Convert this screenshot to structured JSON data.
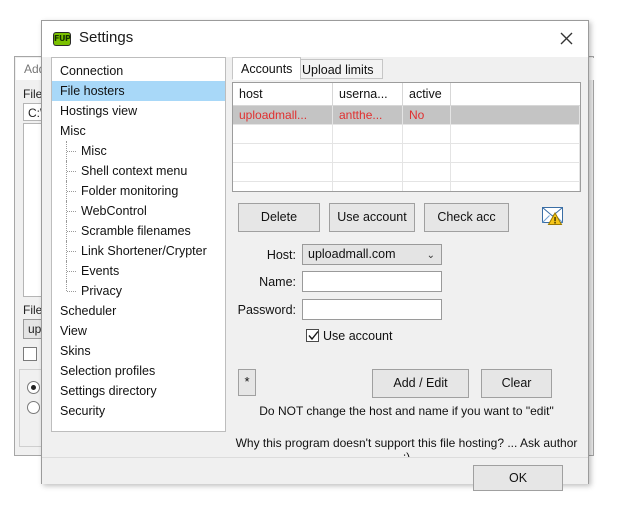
{
  "background_window": {
    "title": "Add",
    "file_label_1": "File",
    "path_value": "C:\\",
    "file_label_2": "File",
    "upload_field": "upl",
    "help_marker": "[?]",
    "close_icon": "close-icon"
  },
  "dialog": {
    "icon": "fup-app-icon",
    "icon_text": "FUP",
    "title": "Settings",
    "close_label": "✕",
    "ok_label": "OK",
    "footnote": "Why this program doesn't support this file hosting? ... Ask author :)"
  },
  "sidebar": {
    "items": [
      {
        "label": "Connection",
        "level": 0,
        "selected": false
      },
      {
        "label": "File hosters",
        "level": 0,
        "selected": true
      },
      {
        "label": "Hostings view",
        "level": 0,
        "selected": false
      },
      {
        "label": "Misc",
        "level": 0,
        "selected": false
      },
      {
        "label": "Misc",
        "level": 1,
        "selected": false
      },
      {
        "label": "Shell context menu",
        "level": 1,
        "selected": false
      },
      {
        "label": "Folder monitoring",
        "level": 1,
        "selected": false
      },
      {
        "label": "WebControl",
        "level": 1,
        "selected": false
      },
      {
        "label": "Scramble filenames",
        "level": 1,
        "selected": false
      },
      {
        "label": "Link Shortener/Crypter",
        "level": 1,
        "selected": false
      },
      {
        "label": "Events",
        "level": 1,
        "selected": false
      },
      {
        "label": "Privacy",
        "level": 1,
        "selected": false,
        "last": true
      },
      {
        "label": "Scheduler",
        "level": 0,
        "selected": false
      },
      {
        "label": "View",
        "level": 0,
        "selected": false
      },
      {
        "label": "Skins",
        "level": 0,
        "selected": false
      },
      {
        "label": "Selection profiles",
        "level": 0,
        "selected": false
      },
      {
        "label": "Settings directory",
        "level": 0,
        "selected": false
      },
      {
        "label": "Security",
        "level": 0,
        "selected": false
      }
    ]
  },
  "tabs": [
    {
      "label": "Accounts",
      "active": true
    },
    {
      "label": "Upload limits",
      "active": false
    }
  ],
  "accounts_table": {
    "columns": [
      "host",
      "userna...",
      "active",
      ""
    ],
    "rows": [
      {
        "selected": true,
        "cells": [
          "uploadmall...",
          "antthe...",
          "No",
          ""
        ]
      },
      {
        "selected": false,
        "cells": [
          "",
          "",
          "",
          ""
        ]
      },
      {
        "selected": false,
        "cells": [
          "",
          "",
          "",
          ""
        ]
      },
      {
        "selected": false,
        "cells": [
          "",
          "",
          "",
          ""
        ]
      },
      {
        "selected": false,
        "cells": [
          "",
          "",
          "",
          ""
        ]
      }
    ],
    "row_text_color": "#e03030",
    "selected_row_bg": "#c4c4c4"
  },
  "action_buttons": {
    "delete": "Delete",
    "use_account": "Use account",
    "check_acc": "Check acc",
    "mail_warning_icon": "mail-warning-icon"
  },
  "form": {
    "host_label": "Host:",
    "host_value": "uploadmall.com",
    "host_arrow": "⌄",
    "name_label": "Name:",
    "name_value": "",
    "password_label": "Password:",
    "password_value": "",
    "use_account_checkbox": {
      "label": "Use account",
      "checked": true
    }
  },
  "edit_buttons": {
    "star": "*",
    "add_edit": "Add / Edit",
    "clear": "Clear",
    "hint": "Do NOT change the host and name if you want to \"edit\""
  },
  "colors": {
    "accent_selection": "#a8d8f8",
    "dialog_bg": "#f0f0f0",
    "button_bg": "#e6e6e6",
    "error_text": "#e03030"
  }
}
